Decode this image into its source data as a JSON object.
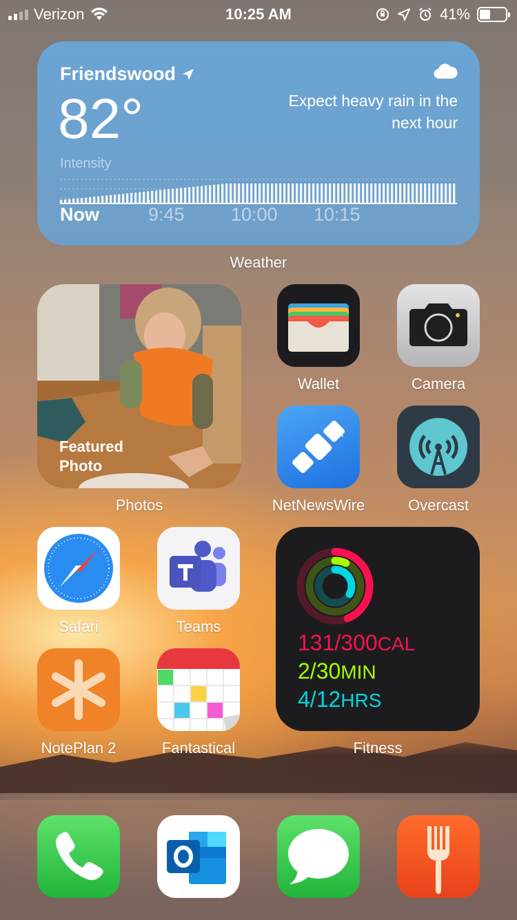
{
  "status_bar": {
    "carrier": "Verizon",
    "time": "10:25 AM",
    "battery_percent": "41%",
    "battery_level": 0.41
  },
  "weather_widget": {
    "location": "Friendswood",
    "temperature": "82°",
    "forecast": "Expect heavy rain in the next hour",
    "intensity_label": "Intensity",
    "time_labels": [
      "Now",
      "9:45",
      "10:00",
      "10:15"
    ],
    "app_label": "Weather"
  },
  "photos_widget": {
    "caption": "Featured Photo",
    "app_label": "Photos"
  },
  "apps": {
    "wallet": "Wallet",
    "camera": "Camera",
    "netnewswire": "NetNewsWire",
    "overcast": "Overcast",
    "safari": "Safari",
    "teams": "Teams",
    "noteplan": "NotePlan 2",
    "fantastical": "Fantastical"
  },
  "fitness_widget": {
    "move_value": "131/300",
    "move_unit": "CAL",
    "exercise_value": "2/30",
    "exercise_unit": "MIN",
    "stand_value": "4/12",
    "stand_unit": "HRS",
    "move_progress": 0.44,
    "exercise_progress": 0.07,
    "stand_progress": 0.33,
    "move_color": "#fa114f",
    "exercise_color": "#a6ff00",
    "stand_color": "#00d7e0",
    "app_label": "Fitness"
  },
  "dock": [
    "phone-icon",
    "outlook-icon",
    "messages-icon",
    "spoon-fork-icon"
  ]
}
